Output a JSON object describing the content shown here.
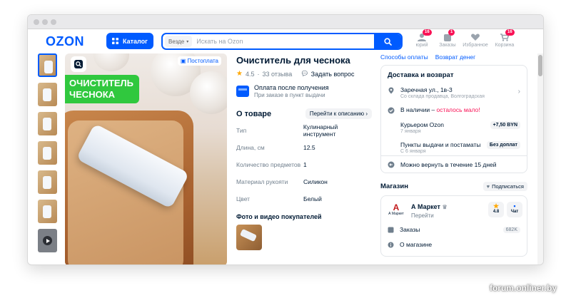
{
  "header": {
    "logo": "OZON",
    "catalog_label": "Каталог",
    "search_scope": "Везде",
    "search_placeholder": "Искать на Ozon",
    "icons": [
      {
        "label": "юрий",
        "badge": "16"
      },
      {
        "label": "Заказы",
        "badge": "1"
      },
      {
        "label": "Избранное",
        "badge": ""
      },
      {
        "label": "Корзина",
        "badge": "16"
      }
    ]
  },
  "gallery": {
    "promo_line1": "ОЧИСТИТЕЛЬ",
    "promo_line2": "ЧЕСНОКА",
    "postpay_badge": "Постоплата"
  },
  "product": {
    "title": "Очиститель для чеснока",
    "rating": "4.5",
    "reviews": "33 отзыва",
    "ask_question": "Задать вопрос",
    "payment_title": "Оплата после получения",
    "payment_sub": "При заказе в пункт выдачи",
    "about_title": "О товаре",
    "about_link": "Перейти к описанию",
    "specs": [
      {
        "key": "Тип",
        "value": "Кулинарный инструмент"
      },
      {
        "key": "Длина, см",
        "value": "12.5"
      },
      {
        "key": "Количество предметов",
        "value": "1"
      },
      {
        "key": "Материал рукояти",
        "value": "Силикон"
      },
      {
        "key": "Цвет",
        "value": "Белый"
      }
    ],
    "photos_title": "Фото и видео покупателей"
  },
  "right": {
    "links": [
      "Способы оплаты",
      "Возврат денег"
    ],
    "delivery_title": "Доставка и возврат",
    "address": "Заречная ул., 1в-3",
    "address_sub": "Со склада продавца, Волгоградская",
    "stock_main": "В наличии",
    "stock_sep": " – ",
    "stock_low": "осталось мало!",
    "courier": "Курьером Ozon",
    "courier_date": "7 января",
    "courier_price": "+7,50 BYN",
    "pickup": "Пункты выдачи и постаматы",
    "pickup_date": "С 6 января",
    "pickup_price": "Без доплат",
    "return_text": "Можно вернуть в течение 15 дней",
    "shop_title": "Магазин",
    "subscribe": "Подписаться",
    "shop_name": "А Маркет",
    "shop_logo_mark": "А",
    "shop_logo_caption": "А Маркет",
    "shop_go": "Перейти",
    "shop_rating": "4.8",
    "chat": "Чат",
    "orders": "Заказы",
    "orders_count": "682K",
    "about_shop": "О магазине"
  },
  "watermark": "forum.onliner.by",
  "colors": {
    "brand": "#005bff",
    "promo": "#30c83e",
    "alert": "#f91155",
    "star": "#ffa800"
  }
}
